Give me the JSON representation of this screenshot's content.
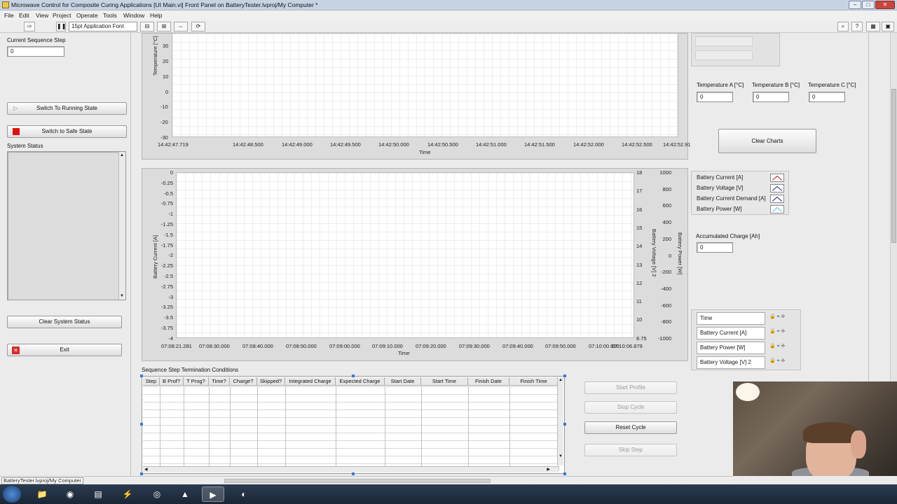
{
  "window": {
    "title": "Microwave Control for Composite Curing Applications [UI Main.vi] Front Panel on BatteryTester.lvproj/My Computer *",
    "controls": {
      "minimize": "–",
      "maximize": "□",
      "close": "✕"
    }
  },
  "menu": [
    "File",
    "Edit",
    "View",
    "Project",
    "Operate",
    "Tools",
    "Window",
    "Help"
  ],
  "toolbar": {
    "font": "15pt Application Font",
    "icons": [
      "run-arrow-icon",
      "pause-icon",
      "align-icon",
      "distribute-icon",
      "resize-icon",
      "reorder-icon",
      "search-icon",
      "help-icon"
    ]
  },
  "left": {
    "current_step_label": "Current Sequence Step",
    "current_step_value": "0",
    "switch_running": "Switch To Running State",
    "switch_safe": "Switch to Safe State",
    "system_status_label": "System Status",
    "clear_status": "Clear System Status",
    "exit": "Exit"
  },
  "temp_chart": {
    "ylabel": "Temperature [°C]",
    "yticks": [
      "30",
      "20",
      "10",
      "0",
      "-10",
      "-20",
      "-30"
    ],
    "xlabel": "Time",
    "xticks": [
      "14:42:47.719",
      "14:42:48.500",
      "14:42:49.000",
      "14:42:49.500",
      "14:42:50.000",
      "14:42:50.500",
      "14:42:51.000",
      "14:42:51.500",
      "14:42:52.000",
      "14:42:52.500",
      "14:42:52.91"
    ]
  },
  "battery_chart": {
    "ylabel_left": "Battery Current [A]",
    "yticks_left": [
      "0",
      "-0.25",
      "-0.5",
      "-0.75",
      "-1",
      "-1.25",
      "-1.5",
      "-1.75",
      "-2",
      "-2.25",
      "-2.5",
      "-2.75",
      "-3",
      "-3.25",
      "-3.5",
      "-3.75",
      "-4"
    ],
    "ylabel_mid": "Battery Voltage [V] 2",
    "yticks_mid": [
      "18",
      "17",
      "16",
      "15",
      "14",
      "13",
      "12",
      "11",
      "10",
      "8.75"
    ],
    "ylabel_right": "Battery Power [W]",
    "yticks_right": [
      "1000",
      "800",
      "600",
      "400",
      "200",
      "0",
      "-200",
      "-400",
      "-600",
      "-800",
      "-1000"
    ],
    "xlabel": "Time",
    "xticks": [
      "07:08:21.281",
      "07:08:30.000",
      "07:08:40.000",
      "07:08:50.000",
      "07:09:00.000",
      "07:09:10.000",
      "07:09:20.000",
      "07:09:30.000",
      "07:09:40.000",
      "07:09:50.000",
      "07:10:00.000",
      "07:10:06.879"
    ]
  },
  "right": {
    "temp_a_label": "Temperature A [°C]",
    "temp_b_label": "Temperature B [°C]",
    "temp_c_label": "Temperature C [°C]",
    "temp_a": "0",
    "temp_b": "0",
    "temp_c": "0",
    "clear_charts": "Clear Charts",
    "legend": [
      {
        "name": "Battery Current [A]",
        "color": "#c0202a"
      },
      {
        "name": "Battery Voltage [V]",
        "color": "#1f3f9e"
      },
      {
        "name": "Battery Current Demand [A]",
        "color": "#2a2a8c"
      },
      {
        "name": "Battery Power [W]",
        "color": "#5cc8e8"
      }
    ],
    "accum_label": "Accumulated Charge [Ah]",
    "accum_value": "0",
    "cursor_rows": [
      "Time",
      "Battery Current [A]",
      "Battery Power [W]",
      "Battery Voltage [V] 2"
    ]
  },
  "table": {
    "title": "Sequence Step Termination Conditions",
    "columns": [
      "Step",
      "B Prof?",
      "T Prog?",
      "Time?",
      "Charge?",
      "Skipped?",
      "Integrated Charge",
      "Expected Charge",
      "Start Date",
      "Start Time",
      "Finish Date",
      "Finish Time"
    ]
  },
  "actions": {
    "start_profile": "Start Profile",
    "stop_cycle": "Stop Cycle",
    "reset_cycle": "Reset Cycle",
    "skip_step": "Skip Step"
  },
  "statusbar": {
    "path": "BatteryTester.lvproj/My Computer"
  }
}
